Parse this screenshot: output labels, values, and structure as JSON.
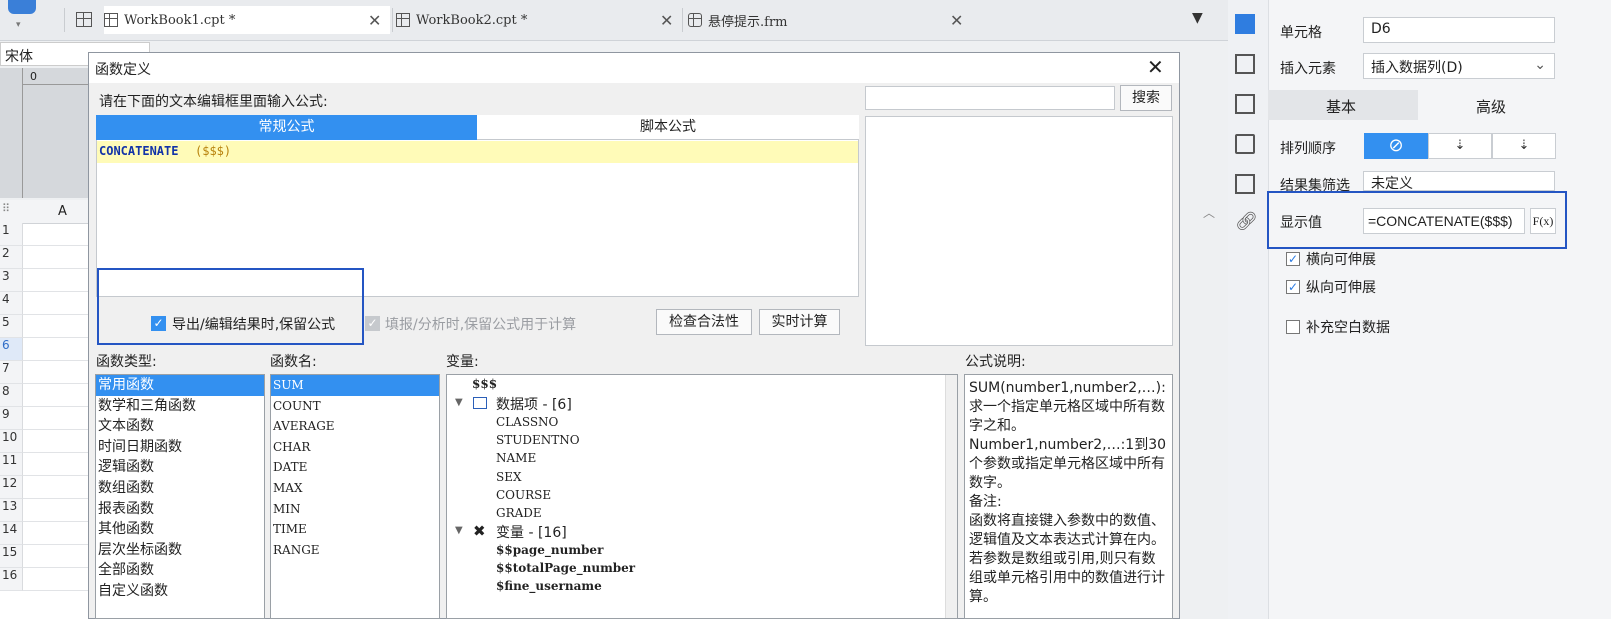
{
  "tabs": [
    {
      "label": "WorkBook1.cpt *"
    },
    {
      "label": "WorkBook2.cpt *"
    },
    {
      "label": "悬停提示.frm"
    }
  ],
  "editor": {
    "font": "宋体",
    "column_a": "A",
    "ruler_zero": "0",
    "rows": [
      "1",
      "2",
      "3",
      "4",
      "5",
      "6",
      "7",
      "8",
      "9",
      "10",
      "11",
      "12",
      "13",
      "14",
      "15",
      "16"
    ]
  },
  "properties": {
    "cell_label": "单元格",
    "cell_value": "D6",
    "insert_label": "插入元素",
    "insert_value": "插入数据列(D)",
    "tab_basic": "基本",
    "tab_advanced": "高级",
    "sort_label": "排列顺序",
    "filter_label": "结果集筛选",
    "filter_value": "未定义",
    "display_label": "显示值",
    "display_value": "=CONCATENATE($$$)",
    "fx_label": "F(x)",
    "h_expand": "横向可伸展",
    "v_expand": "纵向可伸展",
    "fill_blank": "补充空白数据"
  },
  "dialog": {
    "title": "函数定义",
    "prompt": "请在下面的文本编辑框里面输入公式:",
    "tab_normal": "常规公式",
    "tab_script": "脚本公式",
    "formula_fn": "CONCATENATE",
    "formula_args": "($$$)",
    "search_placeholder": "",
    "search_button": "搜索",
    "keep_formula": "导出/编辑结果时,保留公式",
    "keep_formula_fill": "填报/分析时,保留公式用于计算",
    "check_button": "检查合法性",
    "realtime_button": "实时计算",
    "func_type_label": "函数类型:",
    "func_name_label": "函数名:",
    "var_label": "变量:",
    "desc_label": "公式说明:",
    "func_types": [
      "常用函数",
      "数学和三角函数",
      "文本函数",
      "时间日期函数",
      "逻辑函数",
      "数组函数",
      "报表函数",
      "其他函数",
      "层次坐标函数",
      "全部函数",
      "自定义函数"
    ],
    "func_names": [
      "SUM",
      "COUNT",
      "AVERAGE",
      "CHAR",
      "DATE",
      "MAX",
      "MIN",
      "TIME",
      "RANGE"
    ],
    "variables": {
      "root": "$$$",
      "data_group": "数据项 - [6]",
      "data_items": [
        "CLASSNO",
        "STUDENTNO",
        "NAME",
        "SEX",
        "COURSE",
        "GRADE"
      ],
      "var_group": "变量 - [16]",
      "var_items": [
        "$$page_number",
        "$$totalPage_number",
        "$fine_username"
      ]
    },
    "description": "SUM(number1,number2,…):求一个指定单元格区域中所有数字之和。\nNumber1,number2,…:1到30个参数或指定单元格区域中所有数字。\n备注:\n函数将直接键入参数中的数值、逻辑值及文本表达式计算在内。若参数是数组或引用,则只有数组或单元格引用中的数值进行计算。"
  },
  "colors": {
    "accent": "#3390f0",
    "highlight_frame": "#2455c3",
    "formula_line": "#fffbb8"
  }
}
